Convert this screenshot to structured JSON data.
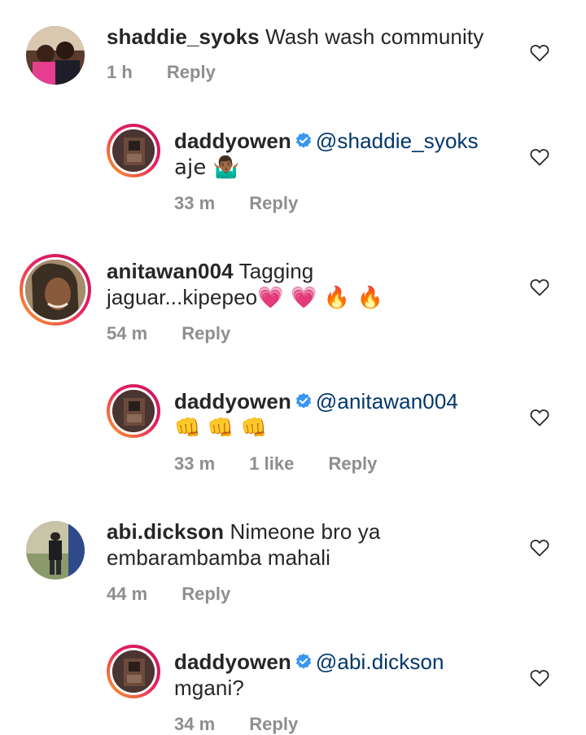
{
  "comments": [
    {
      "username": "shaddie_syoks",
      "text": "Wash wash community",
      "time": "1 h",
      "reply": "Reply"
    },
    {
      "username": "daddyowen",
      "mention": "@shaddie_syoks",
      "text": "aje 🤷🏾‍♂️",
      "time": "33 m",
      "reply": "Reply"
    },
    {
      "username": "anitawan004",
      "text_line1": "Tagging",
      "text_line2": "jaguar...kipepeo",
      "emojis": "💗 💗 🔥 🔥",
      "time": "54 m",
      "reply": "Reply"
    },
    {
      "username": "daddyowen",
      "mention": "@anitawan004",
      "text": "👊 👊 👊",
      "time": "33 m",
      "likes": "1 like",
      "reply": "Reply"
    },
    {
      "username": "abi.dickson",
      "text_line1": "Nimeone bro ya",
      "text_line2": "embarambamba mahali",
      "time": "44 m",
      "reply": "Reply"
    },
    {
      "username": "daddyowen",
      "mention": "@abi.dickson",
      "text": "mgani?",
      "time": "34 m",
      "reply": "Reply"
    }
  ],
  "colors": {
    "text": "#262626",
    "meta": "#8e8e8e",
    "mention": "#00376b",
    "verified": "#3897f0"
  }
}
